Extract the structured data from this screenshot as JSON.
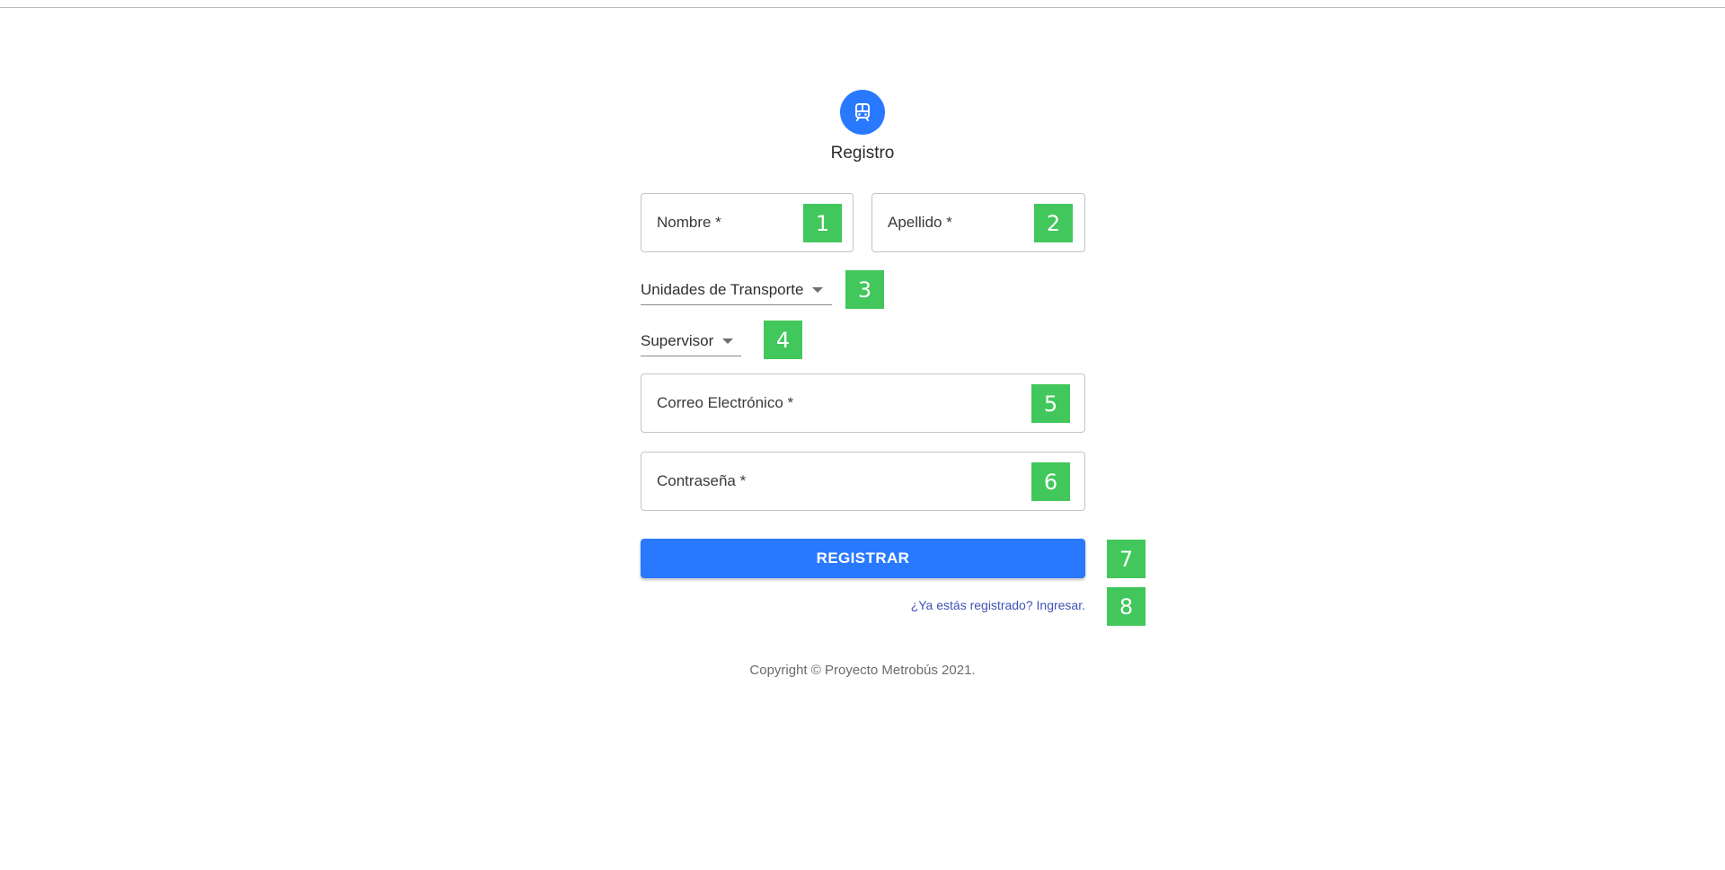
{
  "header": {
    "title": "Registro",
    "logo_icon": "bus-icon",
    "brand_color": "#2979ff"
  },
  "form": {
    "nombre_label": "Nombre *",
    "apellido_label": "Apellido *",
    "unidades_label": "Unidades de Transporte",
    "supervisor_label": "Supervisor",
    "correo_label": "Correo Electrónico *",
    "contrasena_label": "Contraseña *",
    "submit_label": "REGISTRAR",
    "login_link": "¿Ya estás registrado? Ingresar."
  },
  "footer": {
    "copyright": "Copyright © Proyecto Metrobús 2021."
  },
  "badges": {
    "b1": "1",
    "b2": "2",
    "b3": "3",
    "b4": "4",
    "b5": "5",
    "b6": "6",
    "b7": "7",
    "b8": "8",
    "color": "#41c75b"
  }
}
